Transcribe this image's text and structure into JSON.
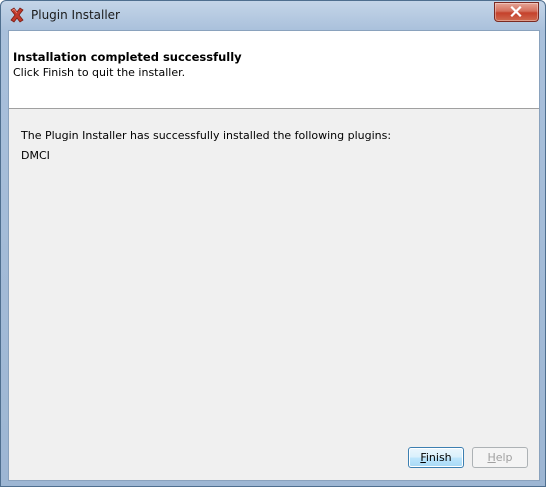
{
  "window": {
    "title": "Plugin Installer"
  },
  "header": {
    "title": "Installation completed successfully",
    "subtitle": "Click Finish to quit the installer."
  },
  "body": {
    "message": "The Plugin Installer has successfully installed the following plugins:",
    "plugins": [
      "DMCI"
    ]
  },
  "buttons": {
    "finish_mnemonic": "F",
    "finish_rest": "inish",
    "help_mnemonic": "H",
    "help_rest": "elp"
  },
  "colors": {
    "accent": "#3c7fb1",
    "app_icon": "#c0392b",
    "close_button": "#c5412b"
  },
  "icons": {
    "app": "red-x-icon",
    "close": "close-x-icon"
  }
}
